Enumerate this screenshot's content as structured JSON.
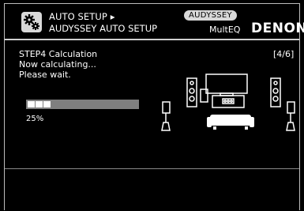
{
  "header": {
    "line1": "AUTO SETUP ▸",
    "line2": "AUDYSSEY AUTO SETUP",
    "brand_badge": "AUDYSSEY",
    "multeq": "MultEQ",
    "denon": "DENON"
  },
  "main": {
    "step_label": "STEP4 Calculation",
    "status_message": "Now calculating...",
    "wait_message": "Please wait.",
    "page_counter": "[4/6]"
  },
  "progress": {
    "percent": 25,
    "label": "25%"
  },
  "icons": {
    "settings": "gear-icon",
    "diagram": "speaker-layout-diagram"
  }
}
